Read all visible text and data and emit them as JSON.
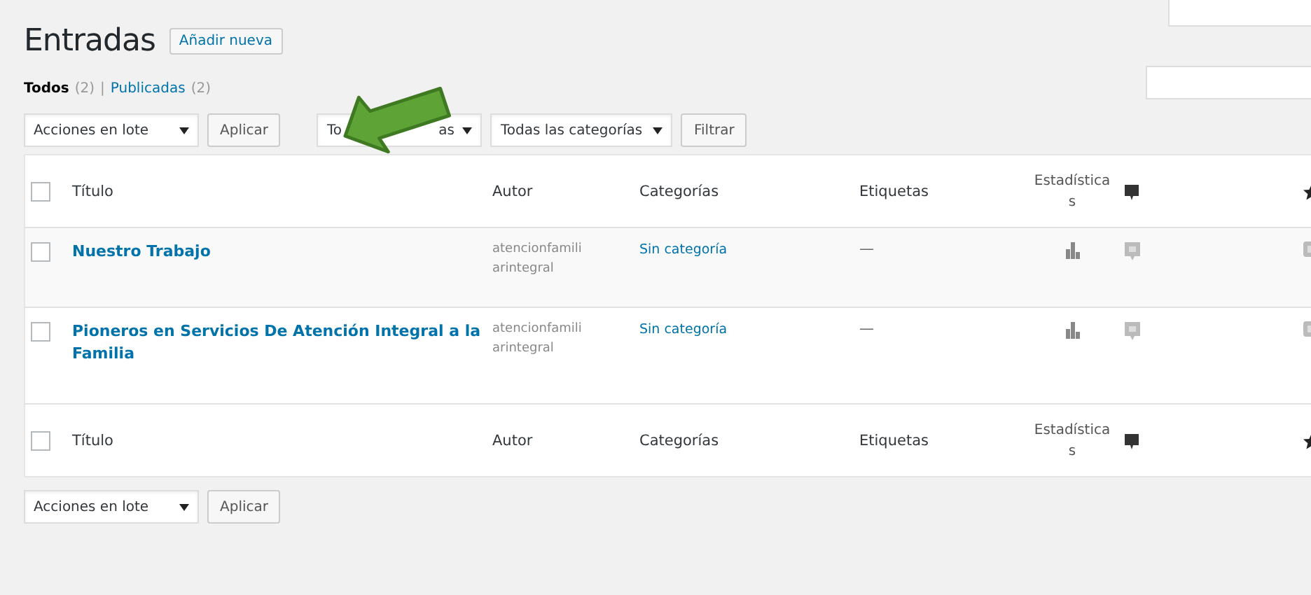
{
  "page_title": "Entradas",
  "add_new": "Añadir nueva",
  "views_separator": "|",
  "header_checkbox": {
    "checked": false
  },
  "footer_checkbox": {
    "checked": false
  },
  "views": [
    {
      "label": "Todos",
      "count": "(2)",
      "selected": true
    },
    {
      "label": "Publicadas",
      "count": "(2)",
      "selected": false
    }
  ],
  "top_nav": {
    "bulk_action": "Acciones en lote",
    "apply": "Aplicar",
    "date_filter_start": "To",
    "date_filter_end": "as",
    "category_filter": "Todas las categorías",
    "filter": "Filtrar"
  },
  "columns": [
    "Título",
    "Autor",
    "Categorías",
    "Etiquetas",
    "Estadísticas"
  ],
  "rows": [
    {
      "checked": false,
      "title": "Nuestro Trabajo",
      "author": "atencionfamiliarintegral",
      "category": "Sin categoría",
      "tags": "—"
    },
    {
      "checked": false,
      "title": "Pioneros en Servicios De Atención Integral a la Familia",
      "author": "atencionfamiliarintegral",
      "category": "Sin categoría",
      "tags": "—"
    }
  ],
  "footer_columns": [
    "Título",
    "Autor",
    "Categorías",
    "Etiquetas",
    "Estadísticas"
  ],
  "bottom_nav": {
    "bulk_action": "Acciones en lote",
    "apply": "Aplicar"
  }
}
